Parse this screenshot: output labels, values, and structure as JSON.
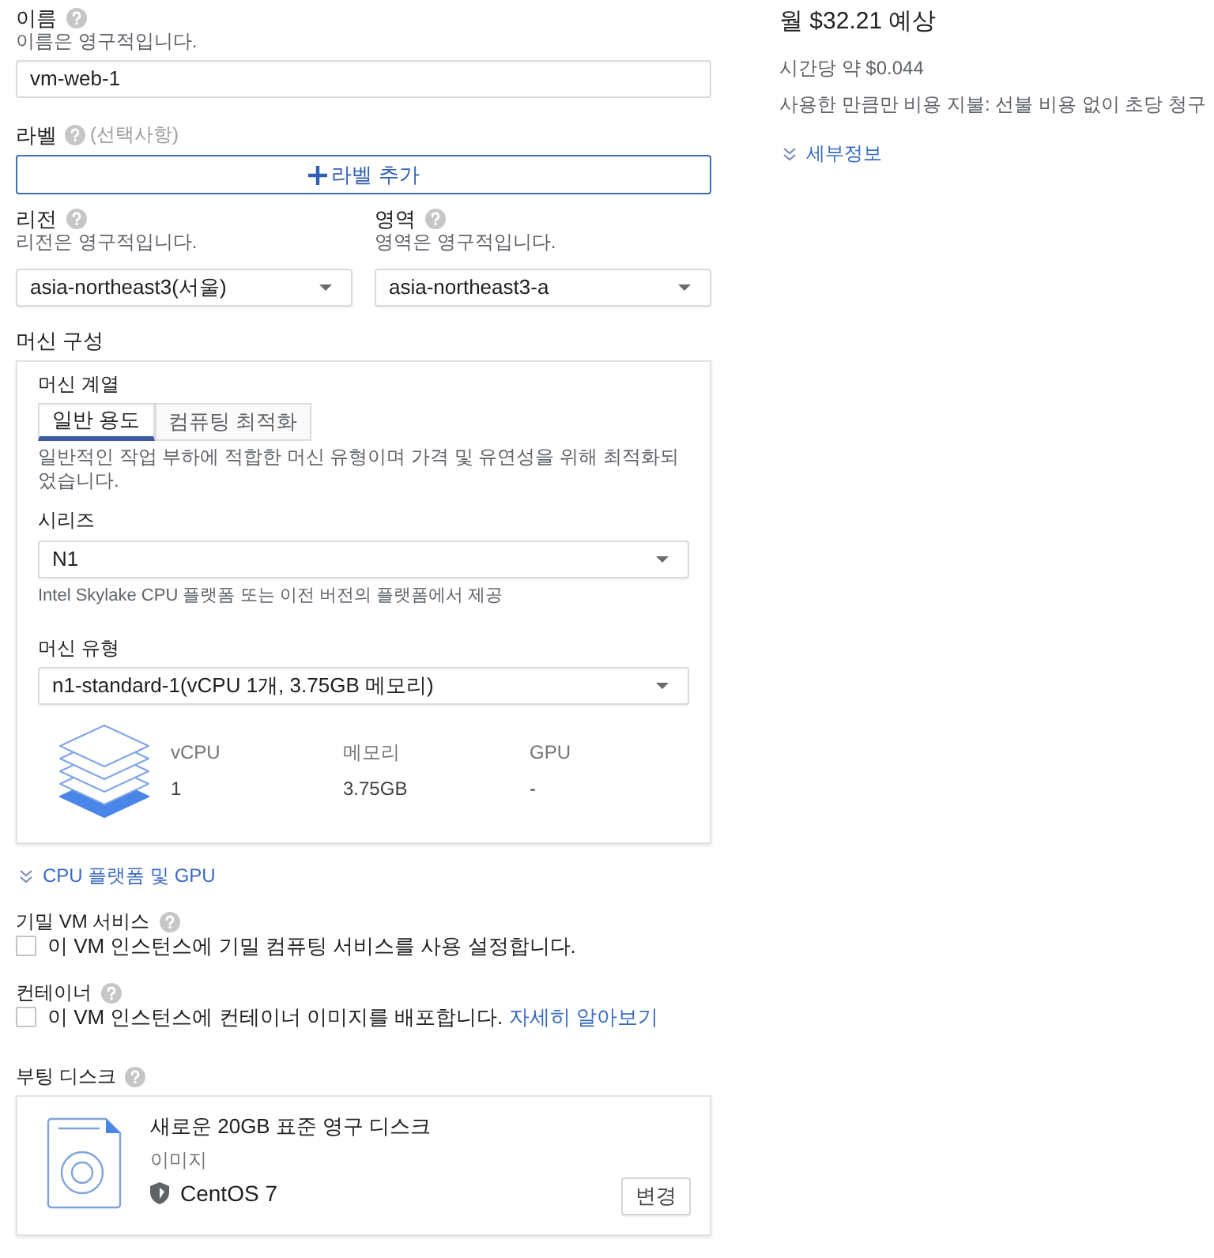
{
  "name_field": {
    "label": "이름",
    "hint": "이름은 영구적입니다.",
    "value": "vm-web-1"
  },
  "labels": {
    "label": "라벨",
    "optional": "(선택사항)",
    "button": "라벨 추가"
  },
  "location": [
    {
      "label": "리전",
      "hint": "리전은 영구적입니다.",
      "value": "asia-northeast3(서울)"
    },
    {
      "label": "영역",
      "hint": "영역은 영구적입니다.",
      "value": "asia-northeast3-a"
    }
  ],
  "machine_config": {
    "title": "머신 구성",
    "family_label": "머신 계열",
    "tabs": [
      {
        "label": "일반 용도",
        "selected": true
      },
      {
        "label": "컴퓨팅 최적화",
        "selected": false
      }
    ],
    "description": "일반적인 작업 부하에 적합한 머신 유형이며 가격 및 유연성을 위해 최적화되었습니다.",
    "series": {
      "label": "시리즈",
      "value": "N1",
      "hint": "Intel Skylake CPU 플랫폼 또는 이전 버전의 플랫폼에서 제공"
    },
    "machine_type": {
      "label": "머신 유형",
      "value": "n1-standard-1(vCPU 1개, 3.75GB 메모리)"
    },
    "specs": [
      {
        "label": "vCPU",
        "value": "1"
      },
      {
        "label": "메모리",
        "value": "3.75GB"
      },
      {
        "label": "GPU",
        "value": "-"
      }
    ]
  },
  "cpu_platform_link": "CPU 플랫폼 및 GPU",
  "options": [
    {
      "title": "기밀 VM 서비스",
      "checkbox_label": "이 VM 인스턴스에 기밀 컴퓨팅 서비스를 사용 설정합니다.",
      "checked": false
    },
    {
      "title": "컨테이너",
      "checkbox_label": "이 VM 인스턴스에 컨테이너 이미지를 배포합니다.",
      "link": "자세히 알아보기",
      "checked": false
    }
  ],
  "boot_disk": {
    "title": "부팅 디스크",
    "disk_name": "새로운 20GB 표준 영구 디스크",
    "image_label": "이미지",
    "image": "CentOS 7",
    "button": "변경"
  },
  "pricing": {
    "monthly": "월 $32.21 예상",
    "hourly": "시간당 약 $0.044",
    "note": "사용한 만큼만 비용 지불: 선불 비용 없이 초당 청구",
    "details_link": "세부정보"
  }
}
